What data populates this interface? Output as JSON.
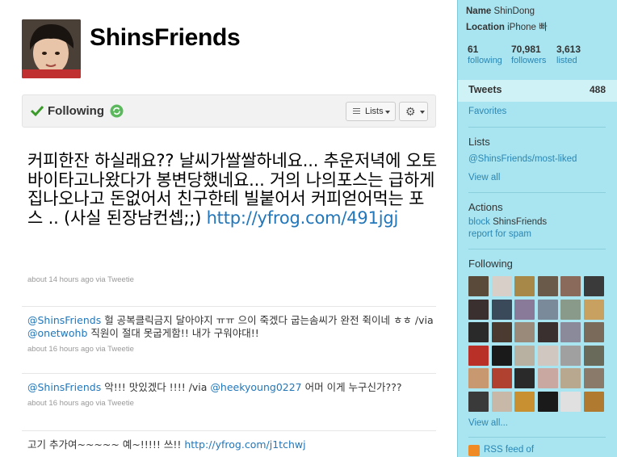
{
  "profile": {
    "screen_name": "ShinsFriends",
    "follow_state": "Following",
    "lists_label": "Lists",
    "gear_label": "⚙"
  },
  "main_tweet": {
    "text": "커피한잔 하실래요?? 날씨가쌀쌀하네요... 추운저녁에 오토바이타고나왔다가 봉변당했네요... 거의 나의포스는 급하게 집나오나고 돈없어서 친구한테 빌붙어서 커피얻어먹는 포스 .. (사실 된장남컨셉;;) ",
    "link": "http://yfrog.com/491jgj",
    "meta": "about 14 hours ago via Tweetie"
  },
  "tweets": [
    {
      "mention": "@ShinsFriends",
      "text": " 헐 공복클릭금지 달아야지 ㅠㅠ 으이 죽겠다 굽는솜씨가 완전 쥑이네 ㅎㅎ /via ",
      "mention2": "@onetwohb",
      "text2": " 직원이 절대 못굽게함!! 내가 구워야대!!",
      "meta": "about 16 hours ago via Tweetie"
    },
    {
      "mention": "@ShinsFriends",
      "text": " 악!!! 맛있겠다 !!!! /via ",
      "mention2": "@heekyoung0227",
      "text2": " 어머 이게 누구신가???",
      "meta": "about 16 hours ago via Tweetie"
    },
    {
      "text": "고기 추가여~~~~~ 예~!!!!! 쓰!! ",
      "link": "http://yfrog.com/j1tchwj"
    }
  ],
  "sidebar": {
    "name_label": "Name",
    "name_value": "ShinDong",
    "location_label": "Location",
    "location_value": "iPhone 빠",
    "stats": [
      {
        "num": "61",
        "label": "following"
      },
      {
        "num": "70,981",
        "label": "followers"
      },
      {
        "num": "3,613",
        "label": "listed"
      }
    ],
    "tweets_label": "Tweets",
    "tweets_count": "488",
    "favorites": "Favorites",
    "lists_head": "Lists",
    "lists_item": "@ShinsFriends/most-liked",
    "view_all": "View all",
    "actions_head": "Actions",
    "block": "block",
    "block_name": "ShinsFriends",
    "report": "report for spam",
    "following_head": "Following",
    "view_all_dots": "View all...",
    "rss": "RSS feed of"
  },
  "following_avatar_colors": [
    "#5a4a3a",
    "#d8d0c8",
    "#a88848",
    "#6a5a4a",
    "#8a6a5a",
    "#3a3a3a",
    "#3a3030",
    "#3a4a5a",
    "#8a7a9a",
    "#7a8a9a",
    "#8a9a8a",
    "#c8a060",
    "#2a2a2a",
    "#4a3a30",
    "#9a8a7a",
    "#3a3030",
    "#8a8a9a",
    "#7a6a5a",
    "#b83028",
    "#1a1a1a",
    "#b8b0a0",
    "#d0c8c0",
    "#a0a0a0",
    "#6a6a5a",
    "#c89870",
    "#b04030",
    "#2a2a2a",
    "#c8a8a0",
    "#b8a890",
    "#8a7a6a",
    "#3a3a3a",
    "#c8b8a8",
    "#c89030",
    "#1a1a1a",
    "#e0e0e0",
    "#b07a30"
  ]
}
